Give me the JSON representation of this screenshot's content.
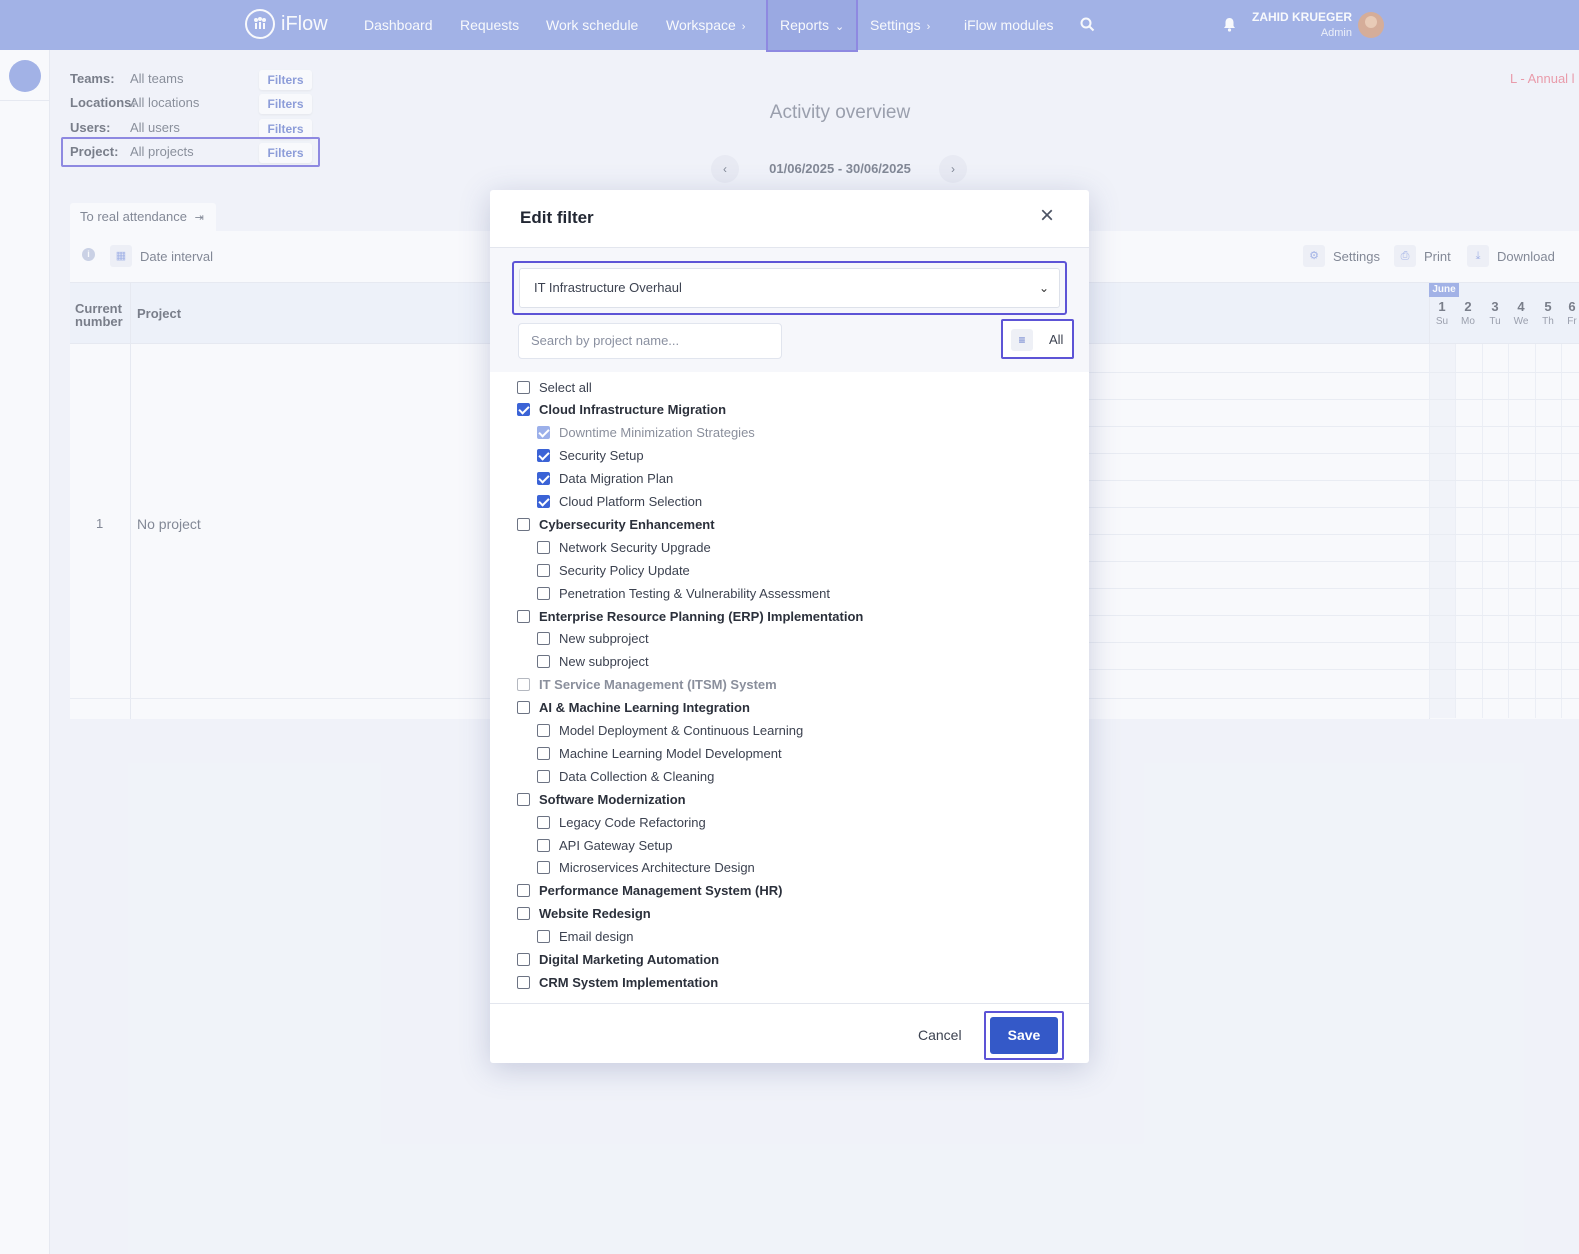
{
  "nav": {
    "logo_text": "iFlow",
    "items": [
      "Dashboard",
      "Requests",
      "Work schedule",
      "Workspace",
      "Reports",
      "Settings",
      "iFlow modules"
    ],
    "user_name": "ZAHID KRUEGER",
    "user_role": "Admin"
  },
  "filters": {
    "teams_label": "Teams:",
    "teams_value": "All teams",
    "locations_label": "Locations:",
    "locations_value": "All locations",
    "users_label": "Users:",
    "users_value": "All users",
    "project_label": "Project:",
    "project_value": "All projects",
    "button_label": "Filters"
  },
  "annual_legend": "L - Annual l",
  "report": {
    "title": "Activity overview",
    "date_range": "01/06/2025 - 30/06/2025",
    "tab_label": "To real attendance",
    "date_interval": "Date interval",
    "settings": "Settings",
    "print": "Print",
    "download": "Download",
    "col_current_1": "Current",
    "col_current_2": "number",
    "col_project": "Project",
    "row_number": "1",
    "row_project": "No project",
    "month": "June",
    "days": [
      {
        "d": "1",
        "w": "Su"
      },
      {
        "d": "2",
        "w": "Mo"
      },
      {
        "d": "3",
        "w": "Tu"
      },
      {
        "d": "4",
        "w": "We"
      },
      {
        "d": "5",
        "w": "Th"
      },
      {
        "d": "6",
        "w": "Fr"
      }
    ]
  },
  "modal": {
    "title": "Edit filter",
    "selected_group": "IT Infrastructure Overhaul",
    "search_placeholder": "Search by project name...",
    "sort_label": "All",
    "cancel": "Cancel",
    "save": "Save",
    "items": [
      {
        "label": "Select all",
        "level": 0,
        "checked": false,
        "bold": false
      },
      {
        "label": "Cloud Infrastructure Migration",
        "level": 0,
        "checked": true,
        "bold": true
      },
      {
        "label": "Downtime Minimization Strategies",
        "level": 1,
        "checked": true,
        "muted": true
      },
      {
        "label": "Security Setup",
        "level": 1,
        "checked": true
      },
      {
        "label": "Data Migration Plan",
        "level": 1,
        "checked": true
      },
      {
        "label": "Cloud Platform Selection",
        "level": 1,
        "checked": true
      },
      {
        "label": "Cybersecurity Enhancement",
        "level": 0,
        "checked": false,
        "bold": true
      },
      {
        "label": "Network Security Upgrade",
        "level": 1,
        "checked": false
      },
      {
        "label": "Security Policy Update",
        "level": 1,
        "checked": false
      },
      {
        "label": "Penetration Testing & Vulnerability Assessment",
        "level": 1,
        "checked": false
      },
      {
        "label": "Enterprise Resource Planning (ERP) Implementation",
        "level": 0,
        "checked": false,
        "bold": true
      },
      {
        "label": "New subproject",
        "level": 1,
        "checked": false
      },
      {
        "label": "New subproject",
        "level": 1,
        "checked": false
      },
      {
        "label": "IT Service Management (ITSM) System",
        "level": 0,
        "checked": false,
        "bold": true,
        "muted": true
      },
      {
        "label": "AI & Machine Learning Integration",
        "level": 0,
        "checked": false,
        "bold": true
      },
      {
        "label": "Model Deployment & Continuous Learning",
        "level": 1,
        "checked": false
      },
      {
        "label": "Machine Learning Model Development",
        "level": 1,
        "checked": false
      },
      {
        "label": "Data Collection & Cleaning",
        "level": 1,
        "checked": false
      },
      {
        "label": "Software Modernization",
        "level": 0,
        "checked": false,
        "bold": true
      },
      {
        "label": "Legacy Code Refactoring",
        "level": 1,
        "checked": false
      },
      {
        "label": "API Gateway Setup",
        "level": 1,
        "checked": false
      },
      {
        "label": "Microservices Architecture Design",
        "level": 1,
        "checked": false
      },
      {
        "label": "Performance Management System (HR)",
        "level": 0,
        "checked": false,
        "bold": true
      },
      {
        "label": "Website Redesign",
        "level": 0,
        "checked": false,
        "bold": true
      },
      {
        "label": "Email design",
        "level": 1,
        "checked": false
      },
      {
        "label": "Digital Marketing Automation",
        "level": 0,
        "checked": false,
        "bold": true
      },
      {
        "label": "CRM System Implementation",
        "level": 0,
        "checked": false,
        "bold": true
      }
    ]
  }
}
